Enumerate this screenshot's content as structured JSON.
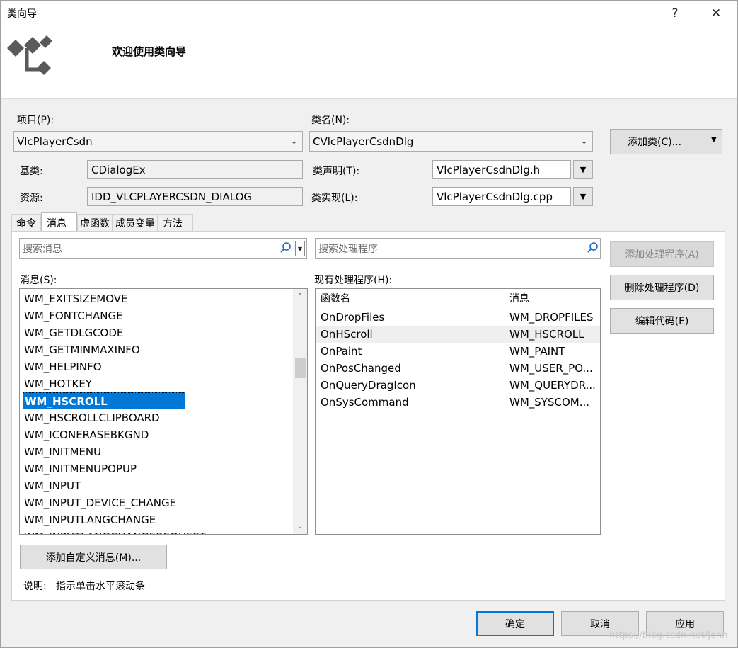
{
  "window": {
    "title": "类向导",
    "help_glyph": "?",
    "close_glyph": "✕"
  },
  "header": {
    "title": "欢迎使用类向导",
    "logo_icon": "class-wizard-icon"
  },
  "project": {
    "label": "项目(P):",
    "value": "VlcPlayerCsdn"
  },
  "classname": {
    "label": "类名(N):",
    "value": "CVlcPlayerCsdnDlg"
  },
  "add_class": {
    "label": "添加类(C)...",
    "arrow": "▼"
  },
  "base_class": {
    "label": "基类:",
    "value": "CDialogEx"
  },
  "resource": {
    "label": "资源:",
    "value": "IDD_VLCPLAYERCSDN_DIALOG"
  },
  "class_decl": {
    "label": "类声明(T):",
    "value": "VlcPlayerCsdnDlg.h"
  },
  "class_impl": {
    "label": "类实现(L):",
    "value": "VlcPlayerCsdnDlg.cpp"
  },
  "tabs": [
    {
      "label": "命令",
      "active": false
    },
    {
      "label": "消息",
      "active": true
    },
    {
      "label": "虚函数",
      "active": false
    },
    {
      "label": "成员变量",
      "active": false
    },
    {
      "label": "方法",
      "active": false
    }
  ],
  "search_messages": {
    "placeholder": "搜索消息"
  },
  "search_handlers": {
    "placeholder": "搜索处理程序"
  },
  "messages": {
    "label": "消息(S):",
    "items": [
      "WM_EXITSIZEMOVE",
      "WM_FONTCHANGE",
      "WM_GETDLGCODE",
      "WM_GETMINMAXINFO",
      "WM_HELPINFO",
      "WM_HOTKEY",
      "WM_HSCROLL",
      "WM_HSCROLLCLIPBOARD",
      "WM_ICONERASEBKGND",
      "WM_INITMENU",
      "WM_INITMENUPOPUP",
      "WM_INPUT",
      "WM_INPUT_DEVICE_CHANGE",
      "WM_INPUTLANGCHANGE",
      "WM_INPUTLANGCHANGEREQUEST"
    ],
    "selected": "WM_HSCROLL"
  },
  "handlers": {
    "label": "现有处理程序(H):",
    "columns": [
      "函数名",
      "消息"
    ],
    "rows": [
      [
        "OnDropFiles",
        "WM_DROPFILES"
      ],
      [
        "OnHScroll",
        "WM_HSCROLL"
      ],
      [
        "OnPaint",
        "WM_PAINT"
      ],
      [
        "OnPosChanged",
        "WM_USER_PO..."
      ],
      [
        "OnQueryDragIcon",
        "WM_QUERYDR..."
      ],
      [
        "OnSysCommand",
        "WM_SYSCOM..."
      ]
    ],
    "highlighted": "OnHScroll"
  },
  "buttons": {
    "add_handler": "添加处理程序(A)",
    "delete_handler": "删除处理程序(D)",
    "edit_code": "编辑代码(E)",
    "add_custom_message": "添加自定义消息(M)...",
    "ok": "确定",
    "cancel": "取消",
    "apply": "应用"
  },
  "description": {
    "label": "说明:",
    "text": "指示单击水平滚动条"
  },
  "watermark": "https://blog.csdn.net/Jonh_"
}
